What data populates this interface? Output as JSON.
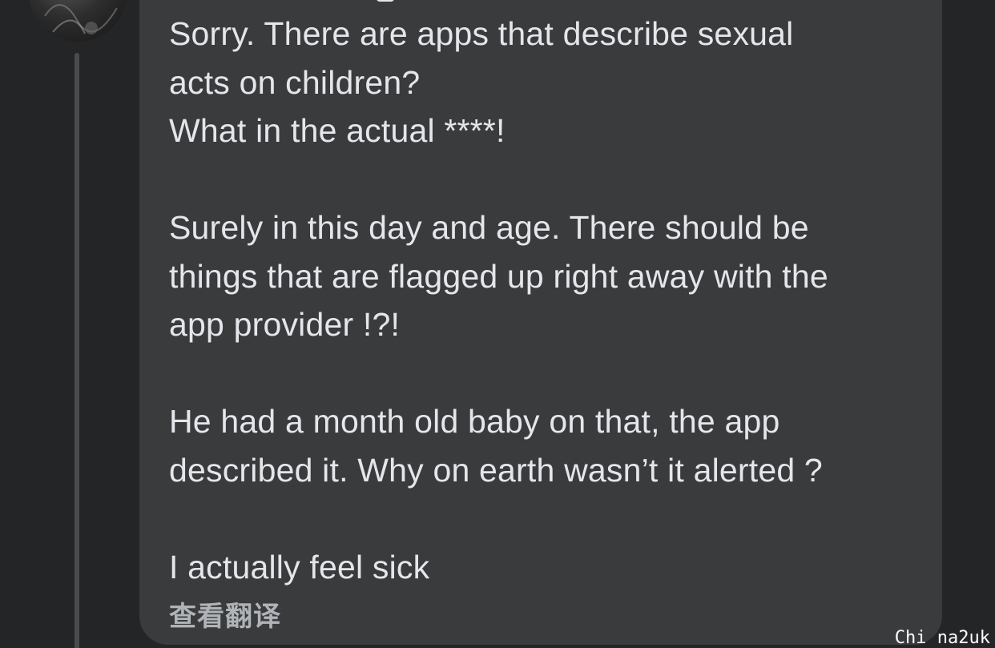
{
  "comment": {
    "lines": [
      "Sorry. There are apps that describe sexual",
      "acts on children?",
      "What in the actual ****!",
      "",
      "Surely in this day and age. There should be",
      "things that are flagged up right away with the",
      "app provider !?!",
      "",
      "He had a month old baby on that, the app",
      "described it. Why on earth wasn’t it alerted ?",
      "",
      "I actually feel sick"
    ],
    "see_translation_label": "查看翻译"
  },
  "watermark": "Chi na2uk",
  "colors": {
    "background": "#242526",
    "bubble": "#3a3b3c",
    "text": "#e4e6eb",
    "secondary_text": "#b0b3b8",
    "thread_line": "#4a4b4d"
  },
  "icons": {
    "avatar": "profile-photo"
  }
}
